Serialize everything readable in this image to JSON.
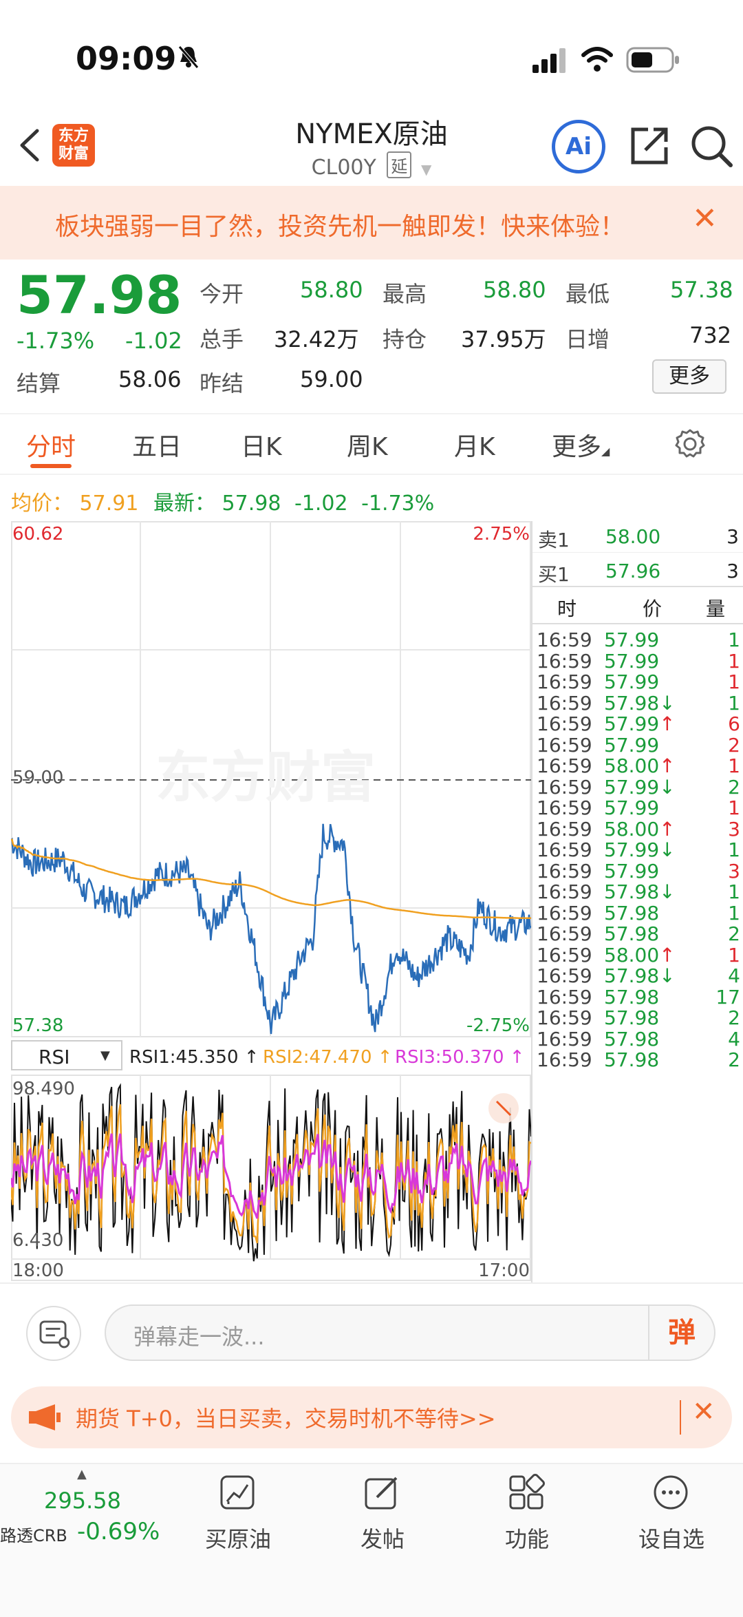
{
  "status_bar": {
    "time": "09:09"
  },
  "header": {
    "logo_line1": "东方",
    "logo_line2": "财富",
    "title": "NYMEX原油",
    "subtitle": "CL00Y",
    "delay_badge": "延",
    "ai_label": "Ai"
  },
  "banner": {
    "text": "板块强弱一目了然，投资先机一触即发！快来体验！",
    "close": "✕"
  },
  "quote": {
    "price": "57.98",
    "change_pct": "-1.73%",
    "change": "-1.02",
    "open_label": "今开",
    "open": "58.80",
    "high_label": "最高",
    "high": "58.80",
    "low_label": "最低",
    "low": "57.38",
    "volume_label": "总手",
    "volume": "32.42万",
    "oi_label": "持仓",
    "oi": "37.95万",
    "oi_change_label": "日增",
    "oi_change": "732",
    "settle_label": "结算",
    "settle": "58.06",
    "prev_settle_label": "昨结",
    "prev_settle": "59.00",
    "more": "更多"
  },
  "tabs": [
    "分时",
    "五日",
    "日K",
    "周K",
    "月K",
    "更多"
  ],
  "avg_info": {
    "avg_label": "均价：",
    "avg": "57.91",
    "latest_label": "最新：",
    "latest": "57.98",
    "change": "-1.02",
    "change_pct": "-1.73%"
  },
  "chart": {
    "y_top": "60.62",
    "y_top_pct": "2.75%",
    "ref_price": "59.00",
    "y_bottom": "57.38",
    "y_bottom_pct": "-2.75%",
    "watermark": "东方财富",
    "indicator": "RSI",
    "rsi1": "RSI1:45.350 ↑",
    "rsi2": "RSI2:47.470 ↑",
    "rsi3": "RSI3:50.370 ↑",
    "rsi_top": "98.490",
    "rsi_bottom": "6.430",
    "time_start": "18:00",
    "time_end": "17:00",
    "colors": {
      "price": "#2a6db8",
      "avg": "#f0a020",
      "rsi1": "#111111",
      "rsi2": "#f0a020",
      "rsi3": "#d838d8"
    }
  },
  "order_book": {
    "ask_label": "卖1",
    "ask_price": "58.00",
    "ask_vol": "3",
    "bid_label": "买1",
    "bid_price": "57.96",
    "bid_vol": "3",
    "col_time": "时",
    "col_price": "价",
    "col_vol": "量",
    "trades": [
      {
        "t": "16:59",
        "p": "57.99",
        "d": "",
        "v": "1",
        "vc": "g"
      },
      {
        "t": "16:59",
        "p": "57.99",
        "d": "",
        "v": "1",
        "vc": "r"
      },
      {
        "t": "16:59",
        "p": "57.99",
        "d": "",
        "v": "1",
        "vc": "r"
      },
      {
        "t": "16:59",
        "p": "57.98",
        "d": "↓",
        "v": "1",
        "vc": "g"
      },
      {
        "t": "16:59",
        "p": "57.99",
        "d": "↑",
        "v": "6",
        "vc": "r"
      },
      {
        "t": "16:59",
        "p": "57.99",
        "d": "",
        "v": "2",
        "vc": "r"
      },
      {
        "t": "16:59",
        "p": "58.00",
        "d": "↑",
        "v": "1",
        "vc": "r"
      },
      {
        "t": "16:59",
        "p": "57.99",
        "d": "↓",
        "v": "2",
        "vc": "g"
      },
      {
        "t": "16:59",
        "p": "57.99",
        "d": "",
        "v": "1",
        "vc": "r"
      },
      {
        "t": "16:59",
        "p": "58.00",
        "d": "↑",
        "v": "3",
        "vc": "r"
      },
      {
        "t": "16:59",
        "p": "57.99",
        "d": "↓",
        "v": "1",
        "vc": "g"
      },
      {
        "t": "16:59",
        "p": "57.99",
        "d": "",
        "v": "3",
        "vc": "r"
      },
      {
        "t": "16:59",
        "p": "57.98",
        "d": "↓",
        "v": "1",
        "vc": "g"
      },
      {
        "t": "16:59",
        "p": "57.98",
        "d": "",
        "v": "1",
        "vc": "g"
      },
      {
        "t": "16:59",
        "p": "57.98",
        "d": "",
        "v": "2",
        "vc": "g"
      },
      {
        "t": "16:59",
        "p": "58.00",
        "d": "↑",
        "v": "1",
        "vc": "r"
      },
      {
        "t": "16:59",
        "p": "57.98",
        "d": "↓",
        "v": "4",
        "vc": "g"
      },
      {
        "t": "16:59",
        "p": "57.98",
        "d": "",
        "v": "17",
        "vc": "g"
      },
      {
        "t": "16:59",
        "p": "57.98",
        "d": "",
        "v": "2",
        "vc": "g"
      },
      {
        "t": "16:59",
        "p": "57.98",
        "d": "",
        "v": "4",
        "vc": "g"
      },
      {
        "t": "16:59",
        "p": "57.98",
        "d": "",
        "v": "2",
        "vc": "g"
      }
    ]
  },
  "comment": {
    "placeholder": "弹幕走一波...",
    "send": "弹"
  },
  "promo": {
    "text": "期货 T+0，当日买卖，交易时机不等待>>",
    "close": "✕"
  },
  "bottom_nav": {
    "index_value": "295.58",
    "index_name": "路透CRB",
    "index_change": "-0.69%",
    "items": [
      "买原油",
      "发帖",
      "功能",
      "设自选"
    ]
  }
}
